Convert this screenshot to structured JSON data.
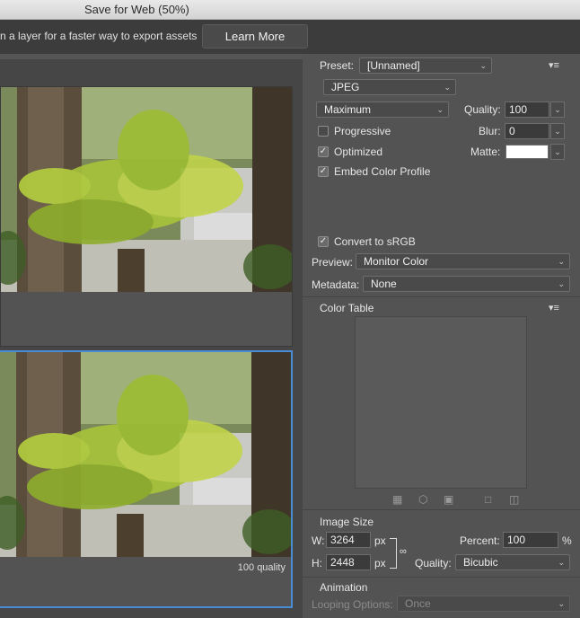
{
  "window": {
    "title": "Save for Web (50%)"
  },
  "banner": {
    "message": "n a layer for a faster way to export assets",
    "learn_more": "Learn More"
  },
  "preview": {
    "optimized_info": "100 quality"
  },
  "settings": {
    "preset_label": "Preset:",
    "preset_value": "[Unnamed]",
    "format": "JPEG",
    "compression": "Maximum",
    "quality_label": "Quality:",
    "quality_value": "100",
    "progressive_label": "Progressive",
    "progressive_checked": false,
    "blur_label": "Blur:",
    "blur_value": "0",
    "optimized_label": "Optimized",
    "optimized_checked": true,
    "matte_label": "Matte:",
    "matte_color": "#ffffff",
    "embed_label": "Embed Color Profile",
    "embed_checked": true,
    "srgb_label": "Convert to sRGB",
    "srgb_checked": true,
    "preview_label": "Preview:",
    "preview_value": "Monitor Color",
    "metadata_label": "Metadata:",
    "metadata_value": "None"
  },
  "color_table": {
    "title": "Color Table"
  },
  "image_size": {
    "title": "Image Size",
    "w_label": "W:",
    "w_value": "3264",
    "h_label": "H:",
    "h_value": "2448",
    "unit": "px",
    "percent_label": "Percent:",
    "percent_value": "100",
    "percent_unit": "%",
    "quality_label": "Quality:",
    "quality_value": "Bicubic"
  },
  "animation": {
    "title": "Animation",
    "looping_label": "Looping Options:",
    "looping_value": "Once"
  },
  "colors": {
    "accent": "#4a8bd6",
    "panel": "#535353",
    "banner": "#3c3c3c"
  }
}
